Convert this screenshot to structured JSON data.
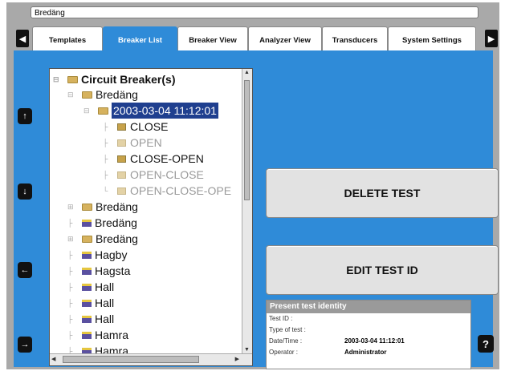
{
  "title_field": {
    "value": "Bredäng"
  },
  "tabs": [
    {
      "label": "Templates",
      "active": false
    },
    {
      "label": "Breaker List",
      "active": true
    },
    {
      "label": "Breaker View",
      "active": false
    },
    {
      "label": "Analyzer View",
      "active": false
    },
    {
      "label": "Transducers",
      "active": false
    },
    {
      "label": "System Settings",
      "active": false
    }
  ],
  "nav": {
    "tab_prev_icon": "left-triangle-icon",
    "tab_next_icon": "right-triangle-icon",
    "up_icon": "arrow-up-icon",
    "down_icon": "arrow-down-icon",
    "left_icon": "arrow-left-icon",
    "right_icon": "arrow-right-icon"
  },
  "tree": {
    "root": "Circuit Breaker(s)",
    "nodes": [
      "Bredäng",
      "2003-03-04 11:12:01",
      "CLOSE",
      "OPEN",
      "CLOSE-OPEN",
      "OPEN-CLOSE",
      "OPEN-CLOSE-OPE",
      "Bredäng",
      "Bredäng",
      "Bredäng",
      "Hagby",
      "Hagsta",
      "Hall",
      "Hall",
      "Hall",
      "Hamra",
      "Hamra"
    ]
  },
  "buttons": {
    "delete_test": "DELETE TEST",
    "edit_test_id": "EDIT TEST ID"
  },
  "identity": {
    "header": "Present test identity",
    "rows": [
      {
        "key": "Test ID :",
        "value": ""
      },
      {
        "key": "Type of test :",
        "value": ""
      },
      {
        "key": "Date/Time :",
        "value": "2003-03-04 11:12:01"
      },
      {
        "key": "Operator :",
        "value": "Administrator"
      }
    ]
  },
  "help": {
    "label": "?"
  },
  "colors": {
    "accent": "#2f8bd8",
    "selection": "#1f3f8f",
    "frame": "#a9a9a9"
  }
}
